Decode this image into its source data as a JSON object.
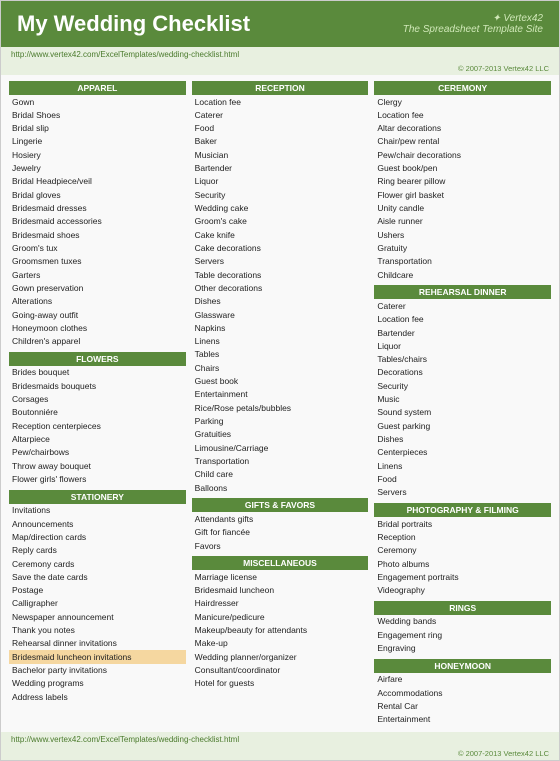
{
  "header": {
    "title": "My Wedding Checklist",
    "logo": "✦ Vertex42",
    "logo_sub": "The Spreadsheet Template Site"
  },
  "url_top": "http://www.vertex42.com/ExcelTemplates/wedding-checklist.html",
  "copyright_top": "© 2007-2013 Vertex42 LLC",
  "url_bottom": "http://www.vertex42.com/ExcelTemplates/wedding-checklist.html",
  "copyright_bottom": "© 2007-2013 Vertex42 LLC",
  "columns": [
    {
      "sections": [
        {
          "header": "APPAREL",
          "items": [
            "Gown",
            "Bridal Shoes",
            "Bridal slip",
            "Lingerie",
            "Hosiery",
            "Jewelry",
            "Bridal Headpiece/veil",
            "Bridal gloves",
            "Bridesmaid dresses",
            "Bridesmaid accessories",
            "Bridesmaid shoes",
            "Groom's tux",
            "Groomsmen tuxes",
            "Garters",
            "Gown preservation",
            "Alterations",
            "Going-away outfit",
            "Honeymoon clothes",
            "Children's apparel"
          ]
        },
        {
          "header": "FLOWERS",
          "items": [
            "Brides bouquet",
            "Bridesmaids bouquets",
            "Corsages",
            "Boutonniére",
            "Reception centerpieces",
            "Altarpiece",
            "Pew/chairbows",
            "Throw away bouquet",
            "Flower girls' flowers"
          ]
        },
        {
          "header": "STATIONERY",
          "items": [
            "Invitations",
            "Announcements",
            "Map/direction cards",
            "Reply cards",
            "Ceremony cards",
            "Save the date cards",
            "Postage",
            "Calligrapher",
            "Newspaper announcement",
            "Thank you notes",
            "Rehearsal dinner invitations",
            "Bridesmaid luncheon invitations",
            "Bachelor party invitations",
            "Wedding programs",
            "Address labels"
          ]
        }
      ]
    },
    {
      "sections": [
        {
          "header": "RECEPTION",
          "items": [
            "Location fee",
            "Caterer",
            "Food",
            "Baker",
            "Musician",
            "Bartender",
            "Liquor",
            "Security",
            "Wedding cake",
            "Groom's cake",
            "Cake knife",
            "Cake decorations",
            "Servers",
            "Table decorations",
            "Other decorations",
            "Dishes",
            "Glassware",
            "Napkins",
            "Linens",
            "Tables",
            "Chairs",
            "Guest book",
            "Entertainment",
            "Rice/Rose petals/bubbles",
            "Parking",
            "Gratuities",
            "Limousine/Carriage",
            "Transportation",
            "Child care",
            "Balloons"
          ]
        },
        {
          "header": "GIFTS & FAVORS",
          "items": [
            "Attendants gifts",
            "Gift for fiancée",
            "Favors"
          ]
        },
        {
          "header": "MISCELLANEOUS",
          "items": [
            "Marriage license",
            "Bridesmaid luncheon",
            "Hairdresser",
            "Manicure/pedicure",
            "Makeup/beauty for attendants",
            "Make-up",
            "Wedding planner/organizer",
            "Consultant/coordinator",
            "Hotel for guests"
          ]
        }
      ]
    },
    {
      "sections": [
        {
          "header": "CEREMONY",
          "items": [
            "Clergy",
            "Location fee",
            "Altar decorations",
            "Chair/pew rental",
            "Pew/chair decorations",
            "Guest book/pen",
            "Ring bearer pillow",
            "Flower girl basket",
            "Unity candle",
            "Aisle runner",
            "Ushers",
            "Gratuity",
            "Transportation",
            "Childcare"
          ]
        },
        {
          "header": "REHEARSAL DINNER",
          "items": [
            "Caterer",
            "Location fee",
            "Bartender",
            "Liquor",
            "Tables/chairs",
            "Decorations",
            "Security",
            "Music",
            "Sound system",
            "Guest parking",
            "Dishes",
            "Centerpieces",
            "Linens",
            "Food",
            "Servers"
          ]
        },
        {
          "header": "PHOTOGRAPHY & FILMING",
          "items": [
            "Bridal portraits",
            "Reception",
            "Ceremony",
            "Photo albums",
            "Engagement portraits",
            "Videography"
          ]
        },
        {
          "header": "RINGS",
          "items": [
            "Wedding bands",
            "Engagement ring",
            "Engraving"
          ]
        },
        {
          "header": "HONEYMOON",
          "items": [
            "Airfare",
            "Accommodations",
            "Rental Car",
            "Entertainment"
          ]
        }
      ]
    }
  ]
}
